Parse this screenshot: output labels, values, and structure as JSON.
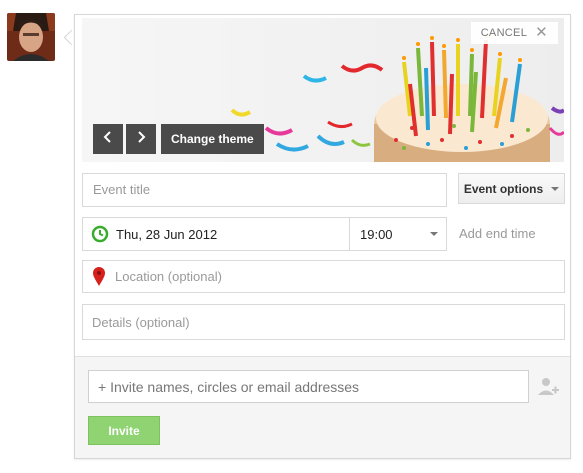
{
  "event": {
    "cancel_label": "CANCEL",
    "change_theme_label": "Change theme",
    "title_placeholder": "Event title",
    "options_label": "Event options",
    "date_value": "Thu, 28 Jun 2012",
    "time_value": "19:00",
    "add_end_time_label": "Add end time",
    "location_placeholder": "Location (optional)",
    "details_placeholder": "Details (optional)"
  },
  "invite": {
    "input_placeholder": "+ Invite names, circles or email addresses",
    "button_label": "Invite"
  },
  "icons": {
    "avatar": "avatar",
    "prev": "chevron-left-icon",
    "next": "chevron-right-icon",
    "clock": "clock-icon",
    "location": "map-pin-icon",
    "add_person": "add-person-icon",
    "close": "close-icon"
  },
  "colors": {
    "accent_green": "#8fd373",
    "clock_green": "#3aac2d",
    "pin_red": "#d6201c",
    "dark_button": "#4a4a4a"
  }
}
